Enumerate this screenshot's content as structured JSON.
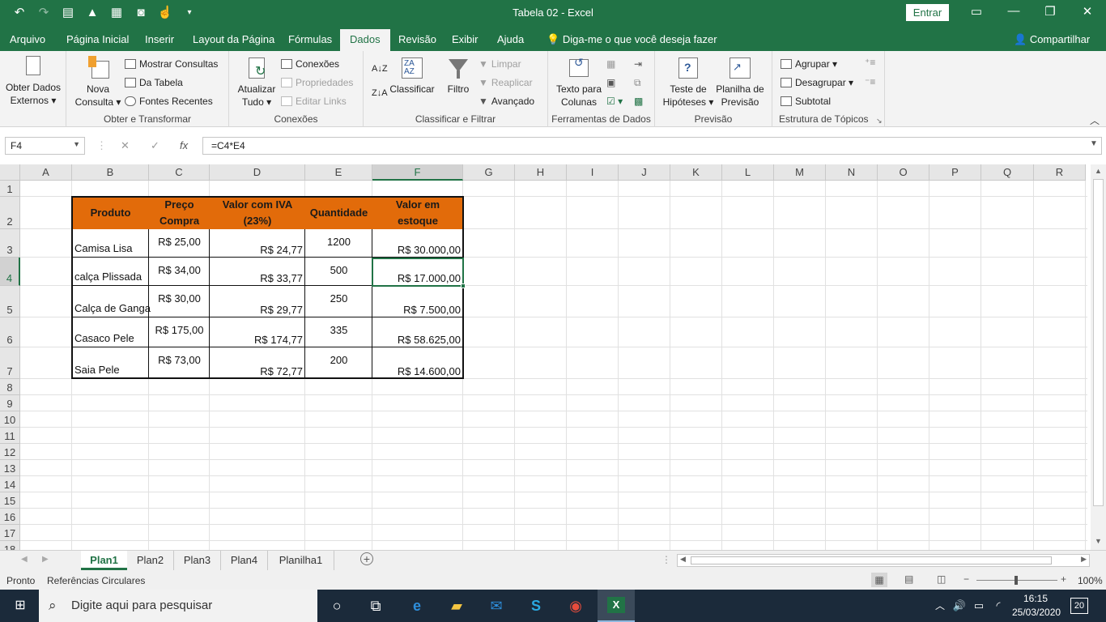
{
  "titlebar": {
    "title": "Tabela 02  -  Excel",
    "signin": "Entrar",
    "qat_icons": [
      "undo-icon",
      "redo-icon",
      "form-icon",
      "warning-icon",
      "sheet-icon",
      "camera-icon",
      "touch-mode-icon",
      "customize-icon"
    ]
  },
  "tabs": [
    "Arquivo",
    "Página Inicial",
    "Inserir",
    "Layout da Página",
    "Fórmulas",
    "Dados",
    "Revisão",
    "Exibir",
    "Ajuda"
  ],
  "active_tab": "Dados",
  "tell_me": "Diga-me o que você deseja fazer",
  "share": "Compartilhar",
  "ribbon": {
    "obter_dados": {
      "line1": "Obter Dados",
      "line2": "Externos"
    },
    "nova_consulta": {
      "line1": "Nova",
      "line2": "Consulta"
    },
    "mostrar_consultas": "Mostrar Consultas",
    "da_tabela": "Da Tabela",
    "fontes_recentes": "Fontes Recentes",
    "group_obter": "Obter e Transformar",
    "atualizar": {
      "line1": "Atualizar",
      "line2": "Tudo"
    },
    "conexoes_btn": "Conexões",
    "propriedades": "Propriedades",
    "editar_links": "Editar Links",
    "group_conexoes": "Conexões",
    "classificar": "Classificar",
    "filtro": "Filtro",
    "limpar": "Limpar",
    "reaplicar": "Reaplicar",
    "avancado": "Avançado",
    "group_classificar": "Classificar e Filtrar",
    "texto_colunas": {
      "line1": "Texto para",
      "line2": "Colunas"
    },
    "group_ferramentas": "Ferramentas de Dados",
    "teste_hipoteses": {
      "line1": "Teste de",
      "line2": "Hipóteses"
    },
    "planilha_previsao": {
      "line1": "Planilha de",
      "line2": "Previsão"
    },
    "group_previsao": "Previsão",
    "agrupar": "Agrupar",
    "desagrupar": "Desagrupar",
    "subtotal": "Subtotal",
    "group_estrutura": "Estrutura de Tópicos"
  },
  "formula_bar": {
    "name_box": "F4",
    "formula": "=C4*E4",
    "fx": "fx"
  },
  "columns": [
    "A",
    "B",
    "C",
    "D",
    "E",
    "F",
    "G",
    "H",
    "I",
    "J",
    "K",
    "L",
    "M",
    "N",
    "O",
    "P",
    "Q",
    "R"
  ],
  "rows": [
    "1",
    "2",
    "3",
    "4",
    "5",
    "6",
    "7",
    "8",
    "9",
    "10",
    "11",
    "12",
    "13",
    "14",
    "15",
    "16",
    "17",
    "18"
  ],
  "selected_cell": "F4",
  "table": {
    "headers": {
      "produto": "Produto",
      "preco_1": "Preço",
      "preco_2": "Compra",
      "iva_1": "Valor com IVA",
      "iva_2": "(23%)",
      "quantidade": "Quantidade",
      "estoque_1": "Valor em",
      "estoque_2": "estoque"
    },
    "rows": [
      {
        "produto": "Camisa Lisa",
        "preco": "R$ 25,00",
        "iva": "R$ 24,77",
        "qtd": "1200",
        "estoque": "R$ 30.000,00"
      },
      {
        "produto": "calça Plissada",
        "preco": "R$ 34,00",
        "iva": "R$ 33,77",
        "qtd": "500",
        "estoque": "R$ 17.000,00"
      },
      {
        "produto": "Calça de Ganga",
        "preco": "R$ 30,00",
        "iva": "R$ 29,77",
        "qtd": "250",
        "estoque": "R$ 7.500,00"
      },
      {
        "produto": "Casaco Pele",
        "preco": "R$ 175,00",
        "iva": "R$ 174,77",
        "qtd": "335",
        "estoque": "R$ 58.625,00"
      },
      {
        "produto": "Saia Pele",
        "preco": "R$ 73,00",
        "iva": "R$ 72,77",
        "qtd": "200",
        "estoque": "R$ 14.600,00"
      }
    ],
    "header_color": "#e26b0a"
  },
  "sheets": [
    "Plan1",
    "Plan2",
    "Plan3",
    "Plan4",
    "Planilha1"
  ],
  "active_sheet": "Plan1",
  "status": {
    "ready": "Pronto",
    "circular": "Referências Circulares",
    "zoom": "100%"
  },
  "taskbar": {
    "search_placeholder": "Digite aqui para pesquisar",
    "time": "16:15",
    "date": "25/03/2020",
    "notifications": "20"
  },
  "colors": {
    "excel_green": "#217346",
    "accent_orange": "#e26b0a"
  }
}
